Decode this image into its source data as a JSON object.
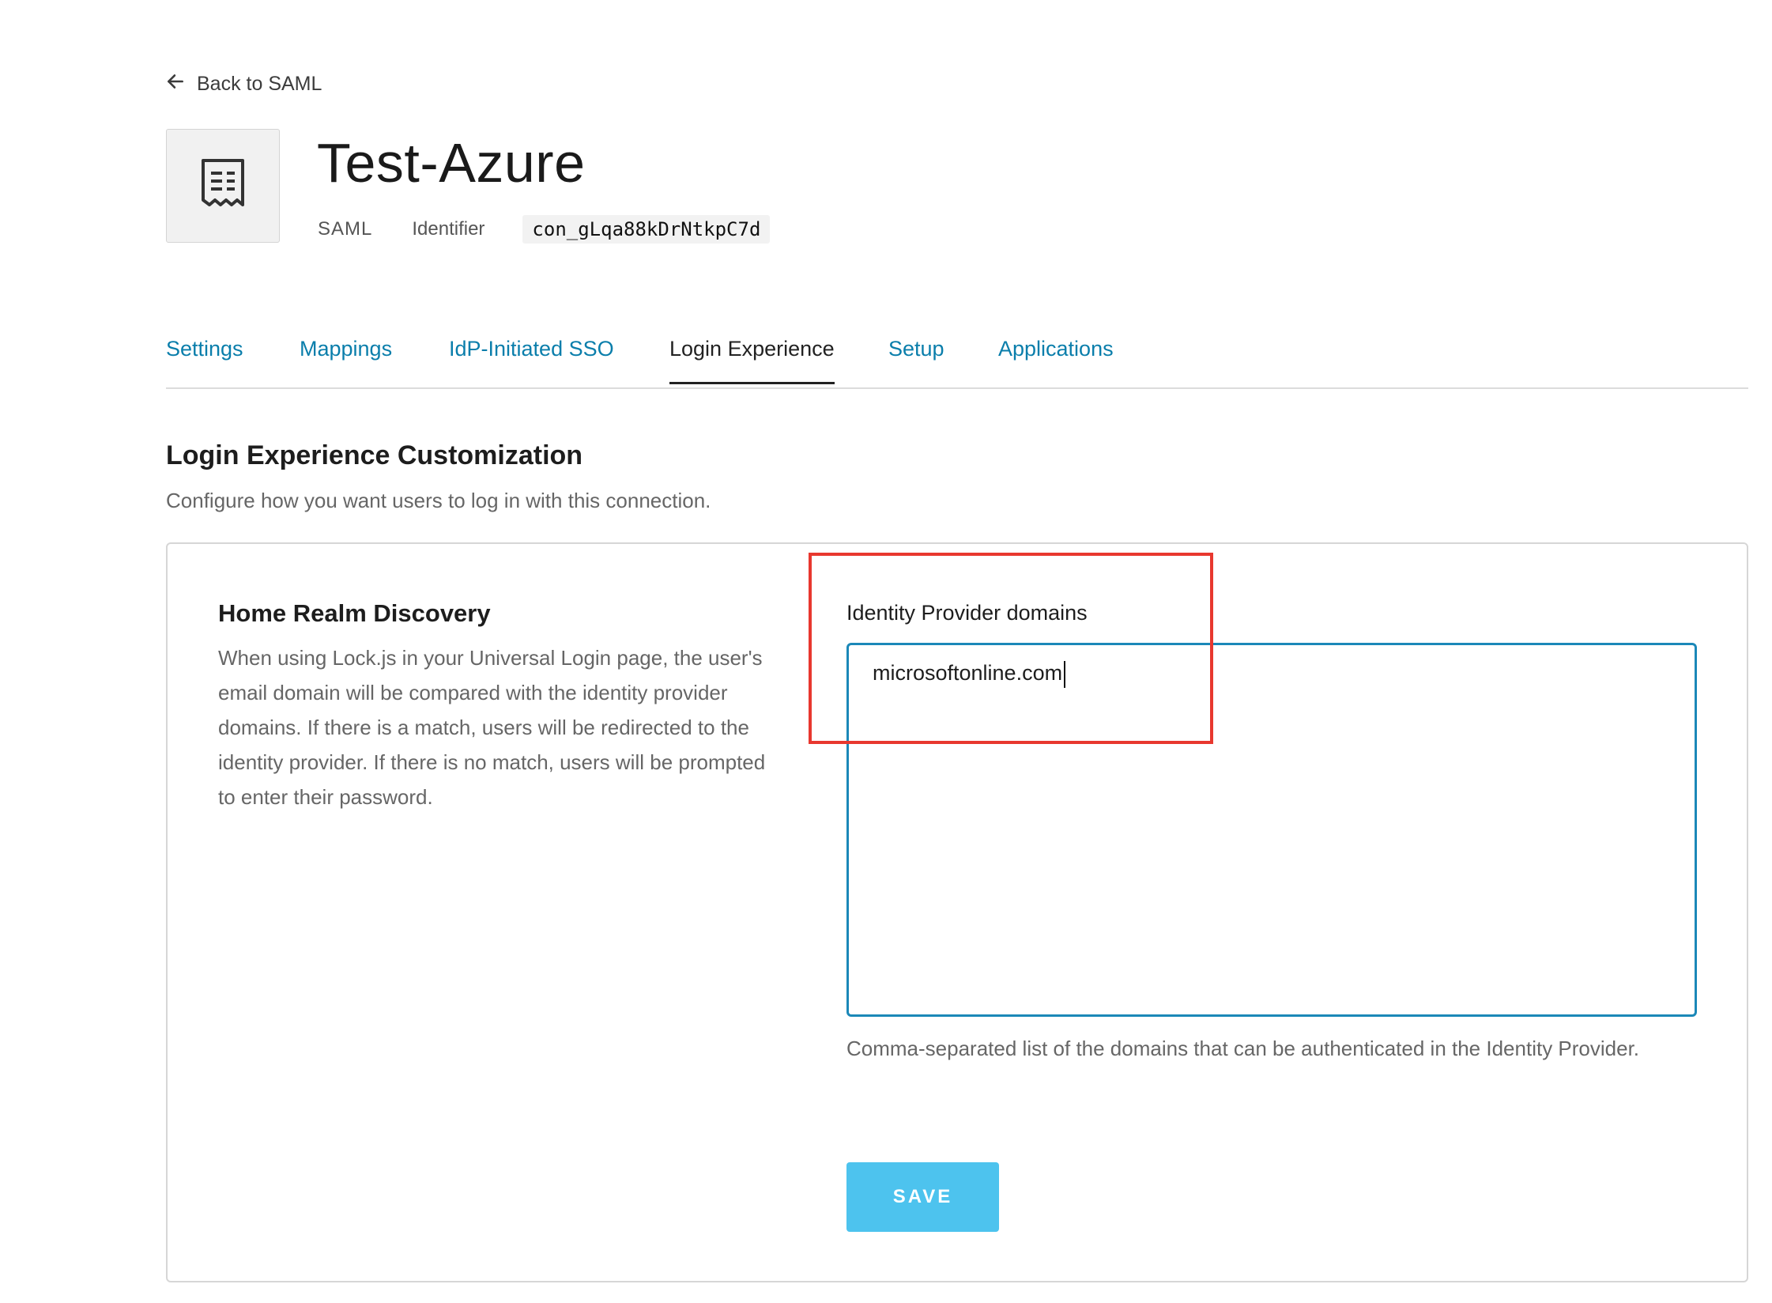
{
  "nav": {
    "back_label": "Back to SAML",
    "back_icon": "arrow-left-icon"
  },
  "connection": {
    "icon": "receipt-document-icon",
    "title": "Test-Azure",
    "type": "SAML",
    "identifier_label": "Identifier",
    "identifier_value": "con_gLqa88kDrNtkpC7d"
  },
  "tabs": [
    {
      "label": "Settings",
      "active": false
    },
    {
      "label": "Mappings",
      "active": false
    },
    {
      "label": "IdP-Initiated SSO",
      "active": false
    },
    {
      "label": "Login Experience",
      "active": true
    },
    {
      "label": "Setup",
      "active": false
    },
    {
      "label": "Applications",
      "active": false
    }
  ],
  "section": {
    "title": "Login Experience Customization",
    "description": "Configure how you want users to log in with this connection."
  },
  "home_realm": {
    "title": "Home Realm Discovery",
    "description": "When using Lock.js in your Universal Login page, the user's email domain will be compared with the identity provider domains. If there is a match, users will be redirected to the identity provider. If there is no match, users will be prompted to enter their password."
  },
  "idp_domains": {
    "label": "Identity Provider domains",
    "value": "microsoftonline.com",
    "help": "Comma-separated list of the domains that can be authenticated in the Identity Provider."
  },
  "actions": {
    "save_label": "SAVE"
  },
  "colors": {
    "link": "#0a7eab",
    "focus_border": "#1b88b8",
    "save_button": "#4dc3ee",
    "annotation": "#e8382f"
  }
}
